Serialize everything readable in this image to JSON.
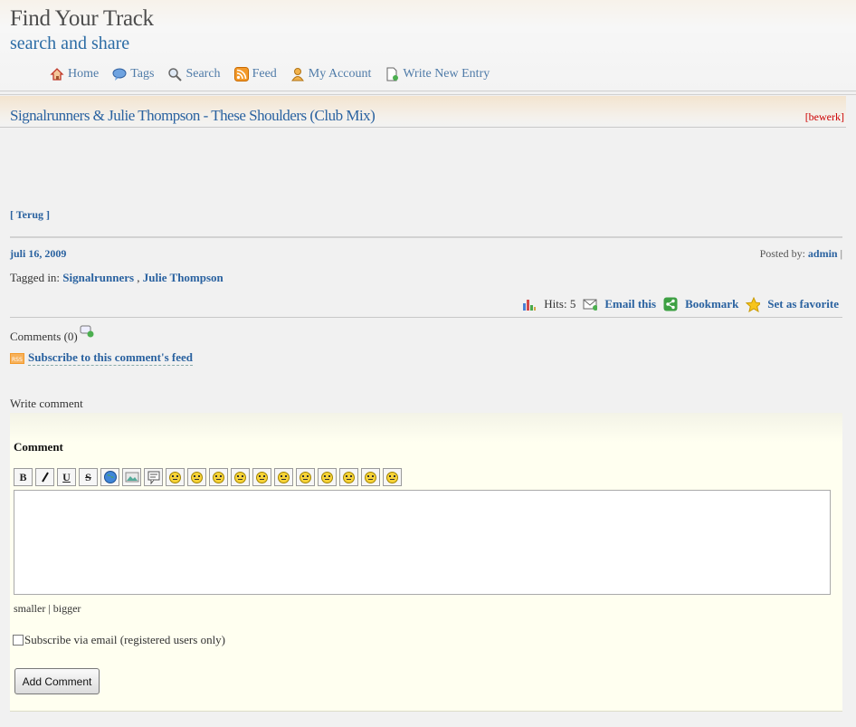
{
  "site": {
    "title": "Find Your Track",
    "subtitle": "search and share"
  },
  "nav": [
    {
      "label": "Home",
      "icon": "home-icon"
    },
    {
      "label": "Tags",
      "icon": "tags-icon"
    },
    {
      "label": "Search",
      "icon": "search-icon"
    },
    {
      "label": "Feed",
      "icon": "rss-icon"
    },
    {
      "label": "My Account",
      "icon": "user-icon"
    },
    {
      "label": "Write New Entry",
      "icon": "new-document-icon"
    }
  ],
  "entry": {
    "title": "Signalrunners & Julie Thompson - These Shoulders (Club Mix)",
    "edit_label": "[bewerk]",
    "back_label": "[ Terug ]",
    "date": "juli 16, 2009",
    "posted_by_label": "Posted by:",
    "author": "admin",
    "posted_sep": " |",
    "tagged_label": "Tagged in:",
    "tags": [
      "Signalrunners",
      "Julie Thompson"
    ],
    "tag_sep": " , "
  },
  "stats": {
    "hits_label": "Hits: 5",
    "email_label": "Email this",
    "bookmark_label": "Bookmark",
    "favorite_label": "Set as favorite"
  },
  "comments": {
    "count_label": "Comments (0)",
    "subscribe_feed_label": "Subscribe to this comment's feed",
    "write_label": "Write comment",
    "form_heading": "Comment",
    "resize_smaller": "smaller",
    "resize_sep": " | ",
    "resize_bigger": "bigger",
    "subscribe_email_label": "Subscribe via email (registered users only)",
    "submit_label": "Add Comment",
    "toolbar": {
      "bold": "B",
      "italic": "I",
      "underline": "U",
      "strike": "S"
    }
  },
  "colors": {
    "link": "#2a62a0",
    "edit": "#cc0000",
    "form_bg": "#fffff0"
  }
}
